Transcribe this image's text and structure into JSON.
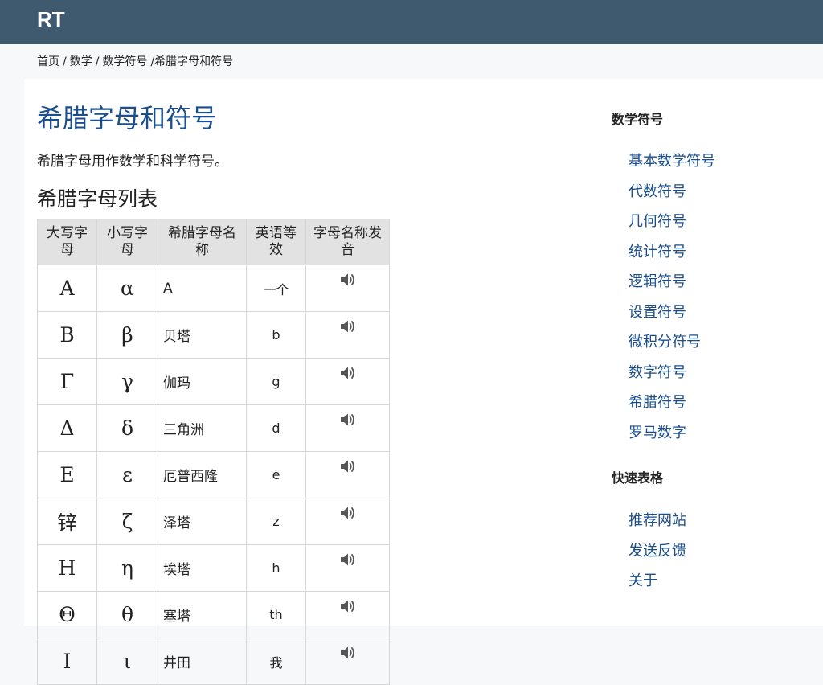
{
  "header": {
    "logo": "RT"
  },
  "breadcrumb": {
    "items": [
      "首页",
      "数学",
      "数学符号"
    ],
    "current": "/希腊字母和符号"
  },
  "main": {
    "title": "希腊字母和符号",
    "intro": "希腊字母用作数学和科学符号。",
    "section_title": "希腊字母列表",
    "table": {
      "headers": [
        "大写字母",
        "小写字母",
        "希腊字母名称",
        "英语等效",
        "字母名称发音"
      ],
      "rows": [
        {
          "upper": "Α",
          "lower": "α",
          "name": "A",
          "english": "一个"
        },
        {
          "upper": "Β",
          "lower": "β",
          "name": "贝塔",
          "english": "b"
        },
        {
          "upper": "Γ",
          "lower": "γ",
          "name": "伽玛",
          "english": "g"
        },
        {
          "upper": "Δ",
          "lower": "δ",
          "name": "三角洲",
          "english": "d"
        },
        {
          "upper": "Ε",
          "lower": "ε",
          "name": "厄普西隆",
          "english": "e"
        },
        {
          "upper": "锌",
          "lower": "ζ",
          "name": "泽塔",
          "english": "z"
        },
        {
          "upper": "Η",
          "lower": "η",
          "name": "埃塔",
          "english": "h"
        },
        {
          "upper": "Θ",
          "lower": "θ",
          "name": "塞塔",
          "english": "th"
        },
        {
          "upper": "Ι",
          "lower": "ι",
          "name": "井田",
          "english": "我"
        }
      ],
      "speaker_icon": "speaker-icon"
    }
  },
  "sidebar": {
    "section1_title": "数学符号",
    "section1_links": [
      "基本数学符号",
      "代数符号",
      "几何符号",
      "统计符号",
      "逻辑符号",
      "设置符号",
      "微积分符号",
      "数字符号",
      "希腊符号",
      "罗马数字"
    ],
    "section2_title": "快速表格",
    "section2_links": [
      "推荐网站",
      "发送反馈",
      "关于"
    ]
  },
  "colors": {
    "header_bg": "#3f5a6f",
    "link": "#1a4e8c",
    "table_header_bg": "#e2e2e2"
  }
}
